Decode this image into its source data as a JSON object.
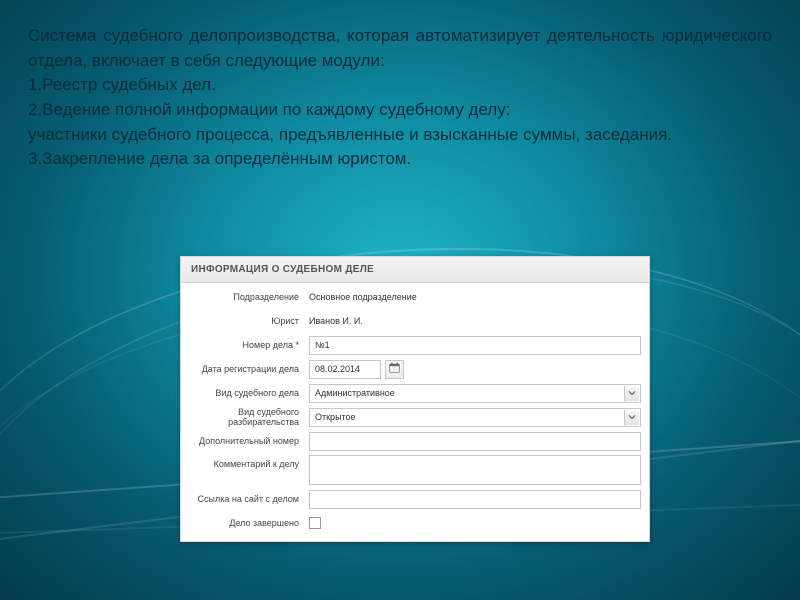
{
  "slide": {
    "intro": "Система судебного делопроизводства, которая автоматизирует деятельность юридического отдела,  включает в себя следующие модули:",
    "bullets": [
      "1.Реестр судебных дел.",
      "2.Ведение полной информации по каждому судебному делу:",
      "участники судебного процесса, предъявленные и взысканные суммы, заседания.",
      "3.Закрепление дела за определённым юристом."
    ]
  },
  "form": {
    "header": "ИНФОРМАЦИЯ О СУДЕБНОМ ДЕЛЕ",
    "rows": {
      "unit_label": "Подразделение",
      "unit_value": "Основное подразделение",
      "lawyer_label": "Юрист",
      "lawyer_value": "Иванов И. И.",
      "number_label": "Номер дела",
      "number_req": "*",
      "number_value": "№1",
      "regdate_label": "Дата регистрации дела",
      "regdate_value": "08.02.2014",
      "kind_label": "Вид судебного дела",
      "kind_value": "Административное",
      "proc_label": "Вид судебного разбирательства",
      "proc_value": "Открытое",
      "addnum_label": "Дополнительный номер",
      "addnum_value": "",
      "comment_label": "Комментарий к делу",
      "link_label": "Ссылка на сайт с делом",
      "link_value": "",
      "closed_label": "Дело завершено"
    }
  }
}
